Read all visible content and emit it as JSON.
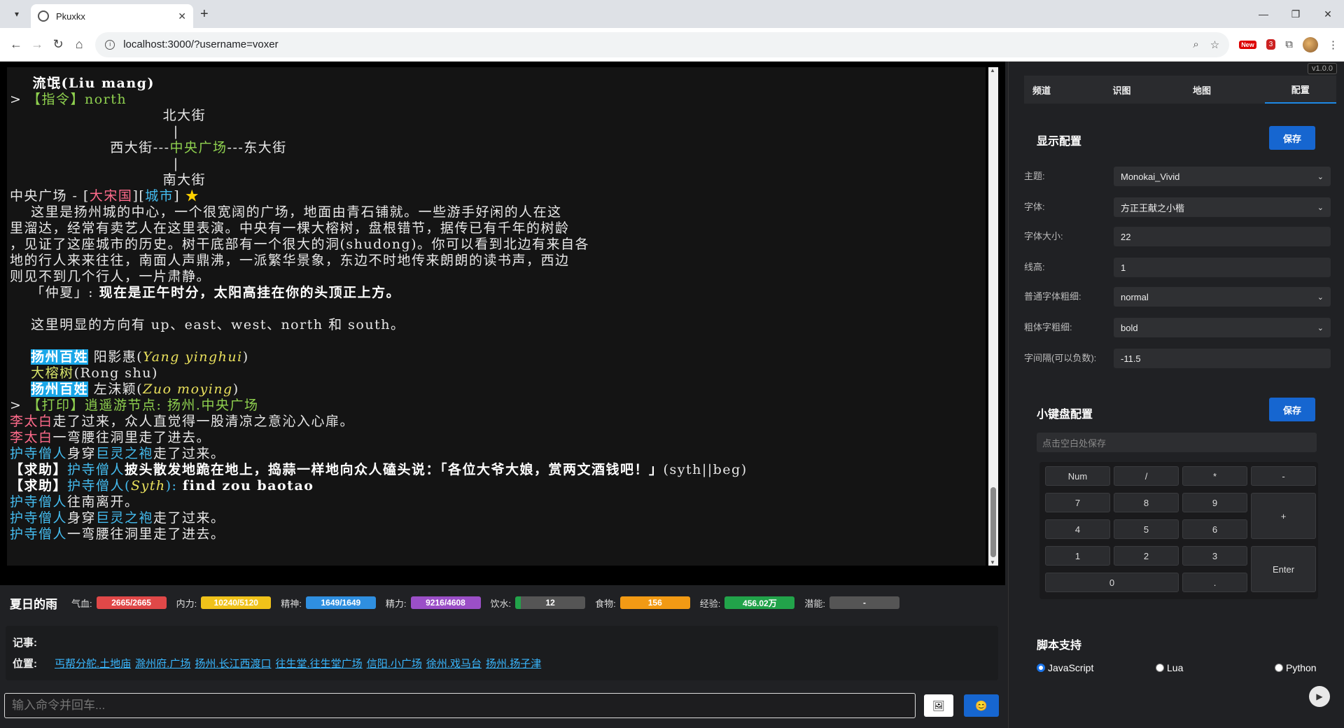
{
  "browser": {
    "tab_title": "Pkuxkx",
    "url": "localhost:3000/?username=voxer",
    "ext_new_badge": "New",
    "ext_count_badge": "3"
  },
  "terminal": {
    "lines": [
      {
        "segs": [
          {
            "t": "    流氓(Liu mang)",
            "c": "w"
          }
        ]
      },
      {
        "segs": [
          {
            "t": "> ",
            "c": ""
          },
          {
            "t": "【指令】north",
            "c": "g"
          }
        ]
      },
      {
        "segs": [
          {
            "t": "                             北大街",
            "c": ""
          }
        ]
      },
      {
        "segs": [
          {
            "t": "                               |",
            "c": ""
          }
        ]
      },
      {
        "segs": [
          {
            "t": "                   西大街---",
            "c": ""
          },
          {
            "t": "中央广场",
            "c": "g"
          },
          {
            "t": "---东大街",
            "c": ""
          }
        ]
      },
      {
        "segs": [
          {
            "t": "                               |",
            "c": ""
          }
        ]
      },
      {
        "segs": [
          {
            "t": "                             南大街",
            "c": ""
          }
        ]
      },
      {
        "segs": [
          {
            "t": "中央广场 - [",
            "c": ""
          },
          {
            "t": "大宋国",
            "c": "pk"
          },
          {
            "t": "][",
            "c": ""
          },
          {
            "t": "城市",
            "c": "b"
          },
          {
            "t": "] ",
            "c": ""
          },
          {
            "t": "★",
            "c": "star"
          }
        ]
      },
      {
        "segs": [
          {
            "t": "    这里是扬州城的中心，一个很宽阔的广场，地面由青石铺就。一些游手好闲的人在这",
            "c": ""
          }
        ]
      },
      {
        "segs": [
          {
            "t": "里溜达，经常有卖艺人在这里表演。中央有一棵大榕树，盘根错节，据传已有千年的树龄",
            "c": ""
          }
        ]
      },
      {
        "segs": [
          {
            "t": "，见证了这座城市的历史。树干底部有一个很大的洞(shudong)。你可以看到北边有来自各",
            "c": ""
          }
        ]
      },
      {
        "segs": [
          {
            "t": "地的行人来来往往，南面人声鼎沸，一派繁华景象，东边不时地传来朗朗的读书声，西边",
            "c": ""
          }
        ]
      },
      {
        "segs": [
          {
            "t": "则见不到几个行人，一片肃静。",
            "c": ""
          }
        ]
      },
      {
        "segs": [
          {
            "t": "    「仲夏」: ",
            "c": ""
          },
          {
            "t": "现在是正午时分，太阳高挂在你的头顶正上方。",
            "c": "w"
          }
        ]
      },
      {
        "segs": [
          {
            "t": " ",
            "c": ""
          }
        ]
      },
      {
        "segs": [
          {
            "t": "    这里明显的方向有 up、east、west、north 和 south。",
            "c": ""
          }
        ]
      },
      {
        "segs": [
          {
            "t": " ",
            "c": ""
          }
        ]
      },
      {
        "segs": [
          {
            "t": "    ",
            "c": ""
          },
          {
            "t": "扬州百姓",
            "c": "tag-b"
          },
          {
            "t": " 阳影惠(",
            "c": ""
          },
          {
            "t": "Yang yinghui",
            "c": "y"
          },
          {
            "t": ")",
            "c": ""
          }
        ]
      },
      {
        "segs": [
          {
            "t": "    ",
            "c": ""
          },
          {
            "t": "大榕树",
            "c": "yl"
          },
          {
            "t": "(Rong shu)",
            "c": ""
          }
        ]
      },
      {
        "segs": [
          {
            "t": "    ",
            "c": ""
          },
          {
            "t": "扬州百姓",
            "c": "tag-b"
          },
          {
            "t": " 左沫颖(",
            "c": ""
          },
          {
            "t": "Zuo moying",
            "c": "y"
          },
          {
            "t": ")",
            "c": ""
          }
        ]
      },
      {
        "segs": [
          {
            "t": "> ",
            "c": ""
          },
          {
            "t": "【打印】逍遥游节点: 扬州.中央广场",
            "c": "g"
          }
        ]
      },
      {
        "segs": [
          {
            "t": "李太白",
            "c": "pk"
          },
          {
            "t": "走了过来，众人直觉得一股清凉之意沁入心扉。",
            "c": ""
          }
        ]
      },
      {
        "segs": [
          {
            "t": "李太白",
            "c": "pk"
          },
          {
            "t": "一弯腰往洞里走了进去。",
            "c": ""
          }
        ]
      },
      {
        "segs": [
          {
            "t": "护寺僧人",
            "c": "b"
          },
          {
            "t": "身穿",
            "c": ""
          },
          {
            "t": "巨灵之袍",
            "c": "b"
          },
          {
            "t": "走了过来。",
            "c": ""
          }
        ]
      },
      {
        "segs": [
          {
            "t": "【求助】",
            "c": "w"
          },
          {
            "t": "护寺僧人",
            "c": "b"
          },
          {
            "t": "披头散发地跪在地上，捣蒜一样地向众人磕头说：「各位大爷大娘，赏两文酒钱吧！」",
            "c": "w"
          },
          {
            "t": "(syth||beg)",
            "c": ""
          }
        ]
      },
      {
        "segs": [
          {
            "t": "【求助】",
            "c": "w"
          },
          {
            "t": "护寺僧人(",
            "c": "b"
          },
          {
            "t": "Syth",
            "c": "y"
          },
          {
            "t": "): ",
            "c": "b"
          },
          {
            "t": "find zou baotao",
            "c": "w"
          }
        ]
      },
      {
        "segs": [
          {
            "t": "护寺僧人",
            "c": "b"
          },
          {
            "t": "往南离开。",
            "c": ""
          }
        ]
      },
      {
        "segs": [
          {
            "t": "护寺僧人",
            "c": "b"
          },
          {
            "t": "身穿",
            "c": ""
          },
          {
            "t": "巨灵之袍",
            "c": "b"
          },
          {
            "t": "走了过来。",
            "c": ""
          }
        ]
      },
      {
        "segs": [
          {
            "t": "护寺僧人",
            "c": "b"
          },
          {
            "t": "一弯腰往洞里走了进去。",
            "c": ""
          }
        ]
      }
    ]
  },
  "status": {
    "player_name": "夏日的雨",
    "stats": [
      {
        "label": "气血:",
        "value": "2665/2665",
        "color": "#e04848"
      },
      {
        "label": "内力:",
        "value": "10240/5120",
        "color": "#f0c21a"
      },
      {
        "label": "精神:",
        "value": "1649/1649",
        "color": "#2f8fe0"
      },
      {
        "label": "精力:",
        "value": "9216/4608",
        "color": "#9b4fc7"
      },
      {
        "label": "饮水:",
        "value": "12",
        "color": "#555555"
      },
      {
        "label": "食物:",
        "value": "156",
        "color": "#f29a14"
      },
      {
        "label": "经验:",
        "value": "456.02万",
        "color": "#22a34a"
      },
      {
        "label": "潜能:",
        "value": "-",
        "color": "#555555"
      }
    ],
    "water_fill": 0.08
  },
  "notes": {
    "notes_label": "记事:",
    "location_label": "位置:",
    "locations": [
      "丐帮分舵.土地庙",
      "滁州府.广场",
      "扬州.长江西渡口",
      "往生堂.往生堂广场",
      "信阳.小广场",
      "徐州.戏马台",
      "扬州.扬子津"
    ]
  },
  "command": {
    "placeholder": "输入命令并回车...",
    "image_icon": "🖼",
    "emoji_icon": "😊"
  },
  "side": {
    "version": "v1.0.0",
    "tabs": [
      "频道",
      "识图",
      "地图",
      "配置"
    ],
    "display_title": "显示配置",
    "save_label": "保存",
    "fields": [
      {
        "label": "主题:",
        "value": "Monokai_Vivid",
        "select": true
      },
      {
        "label": "字体:",
        "value": "方正王献之小楷",
        "select": true
      },
      {
        "label": "字体大小:",
        "value": "22",
        "select": false
      },
      {
        "label": "线高:",
        "value": "1",
        "select": false
      },
      {
        "label": "普通字体粗细:",
        "value": "normal",
        "select": true
      },
      {
        "label": "粗体字粗细:",
        "value": "bold",
        "select": true
      },
      {
        "label": "字间隔(可以负数):",
        "value": "-11.5",
        "select": false
      }
    ],
    "keypad_title": "小键盘配置",
    "keypad_hint": "点击空白处保存",
    "keys": [
      "Num",
      "/",
      "*",
      "-",
      "7",
      "8",
      "9",
      "+",
      "4",
      "5",
      "6",
      "1",
      "2",
      "3",
      "Enter",
      "0",
      "."
    ],
    "script_title": "脚本支持",
    "script_options": [
      "JavaScript",
      "Lua",
      "Python"
    ]
  }
}
